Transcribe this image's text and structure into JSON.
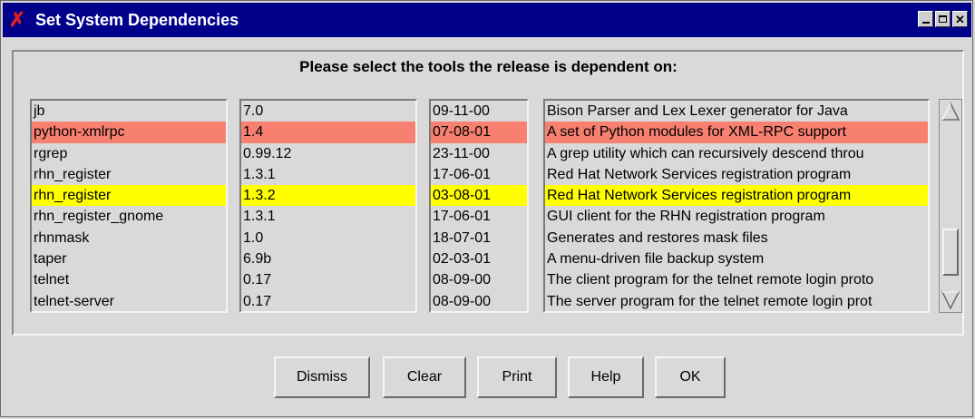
{
  "window": {
    "title": "Set System Dependencies",
    "app_icon": "x-icon"
  },
  "prompt": "Please select the tools the release is dependent on:",
  "rows": [
    {
      "name": "jb",
      "version": "7.0",
      "date": "09-11-00",
      "description": "Bison Parser and Lex Lexer generator for Java",
      "state": ""
    },
    {
      "name": "python-xmlrpc",
      "version": "1.4",
      "date": "07-08-01",
      "description": "A set of Python modules for XML-RPC support",
      "state": "sel-red"
    },
    {
      "name": "rgrep",
      "version": "0.99.12",
      "date": "23-11-00",
      "description": "A grep utility which can recursively descend throu",
      "state": ""
    },
    {
      "name": "rhn_register",
      "version": "1.3.1",
      "date": "17-06-01",
      "description": "Red Hat Network Services registration program",
      "state": ""
    },
    {
      "name": "rhn_register",
      "version": "1.3.2",
      "date": "03-08-01",
      "description": "Red Hat Network Services registration program",
      "state": "sel-yellow"
    },
    {
      "name": "rhn_register_gnome",
      "version": "1.3.1",
      "date": "17-06-01",
      "description": "GUI client for the RHN registration program",
      "state": ""
    },
    {
      "name": "rhnmask",
      "version": "1.0",
      "date": "18-07-01",
      "description": "Generates and restores mask files",
      "state": ""
    },
    {
      "name": "taper",
      "version": "6.9b",
      "date": "02-03-01",
      "description": "A menu-driven file backup system",
      "state": ""
    },
    {
      "name": "telnet",
      "version": "0.17",
      "date": "08-09-00",
      "description": "The client program for the telnet remote login proto",
      "state": ""
    },
    {
      "name": "telnet-server",
      "version": "0.17",
      "date": "08-09-00",
      "description": "The server program for the telnet remote login prot",
      "state": ""
    }
  ],
  "colors": {
    "titlebar": "#00008b",
    "selected_red": "#f88070",
    "selected_yellow": "#ffff00",
    "background": "#d9d9d9"
  },
  "buttons": {
    "dismiss": "Dismiss",
    "clear": "Clear",
    "print": "Print",
    "help": "Help",
    "ok": "OK"
  }
}
